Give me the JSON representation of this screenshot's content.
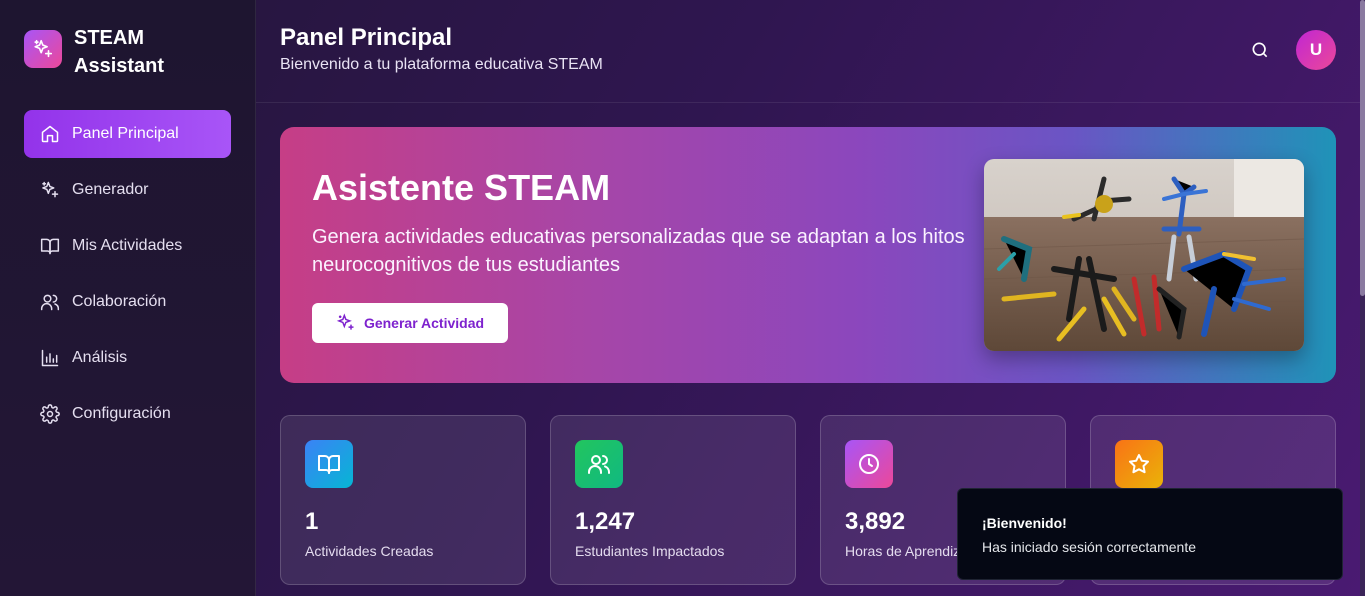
{
  "brand": {
    "line1": "STEAM",
    "line2": "Assistant",
    "logo_icon": "sparkles-icon"
  },
  "sidebar": {
    "items": [
      {
        "label": "Panel Principal",
        "icon": "home-icon",
        "active": true
      },
      {
        "label": "Generador",
        "icon": "sparkles-icon",
        "active": false
      },
      {
        "label": "Mis Actividades",
        "icon": "book-open-icon",
        "active": false
      },
      {
        "label": "Colaboración",
        "icon": "users-icon",
        "active": false
      },
      {
        "label": "Análisis",
        "icon": "bar-chart-icon",
        "active": false
      },
      {
        "label": "Configuración",
        "icon": "gear-icon",
        "active": false
      }
    ]
  },
  "header": {
    "title": "Panel Principal",
    "subtitle": "Bienvenido a tu plataforma educativa STEAM",
    "avatar_initial": "U"
  },
  "hero": {
    "title": "Asistente STEAM",
    "description": "Genera actividades educativas personalizadas que se adaptan a los hitos neurocognitivos de tus estudiantes",
    "button_label": "Generar Actividad"
  },
  "stats": [
    {
      "value": "1",
      "label": "Actividades Creadas",
      "icon": "book-open-icon",
      "color": "#3b82f6"
    },
    {
      "value": "1,247",
      "label": "Estudiantes Impactados",
      "icon": "users-icon",
      "color": "#22c55e"
    },
    {
      "value": "3,892",
      "label": "Horas de Aprendizaje",
      "icon": "clock-icon",
      "color": "#a855f7"
    },
    {
      "value": "",
      "label": "",
      "icon": "star-icon",
      "color": "#f97316"
    }
  ],
  "toast": {
    "title": "¡Bienvenido!",
    "message": "Has iniciado sesión correctamente"
  }
}
